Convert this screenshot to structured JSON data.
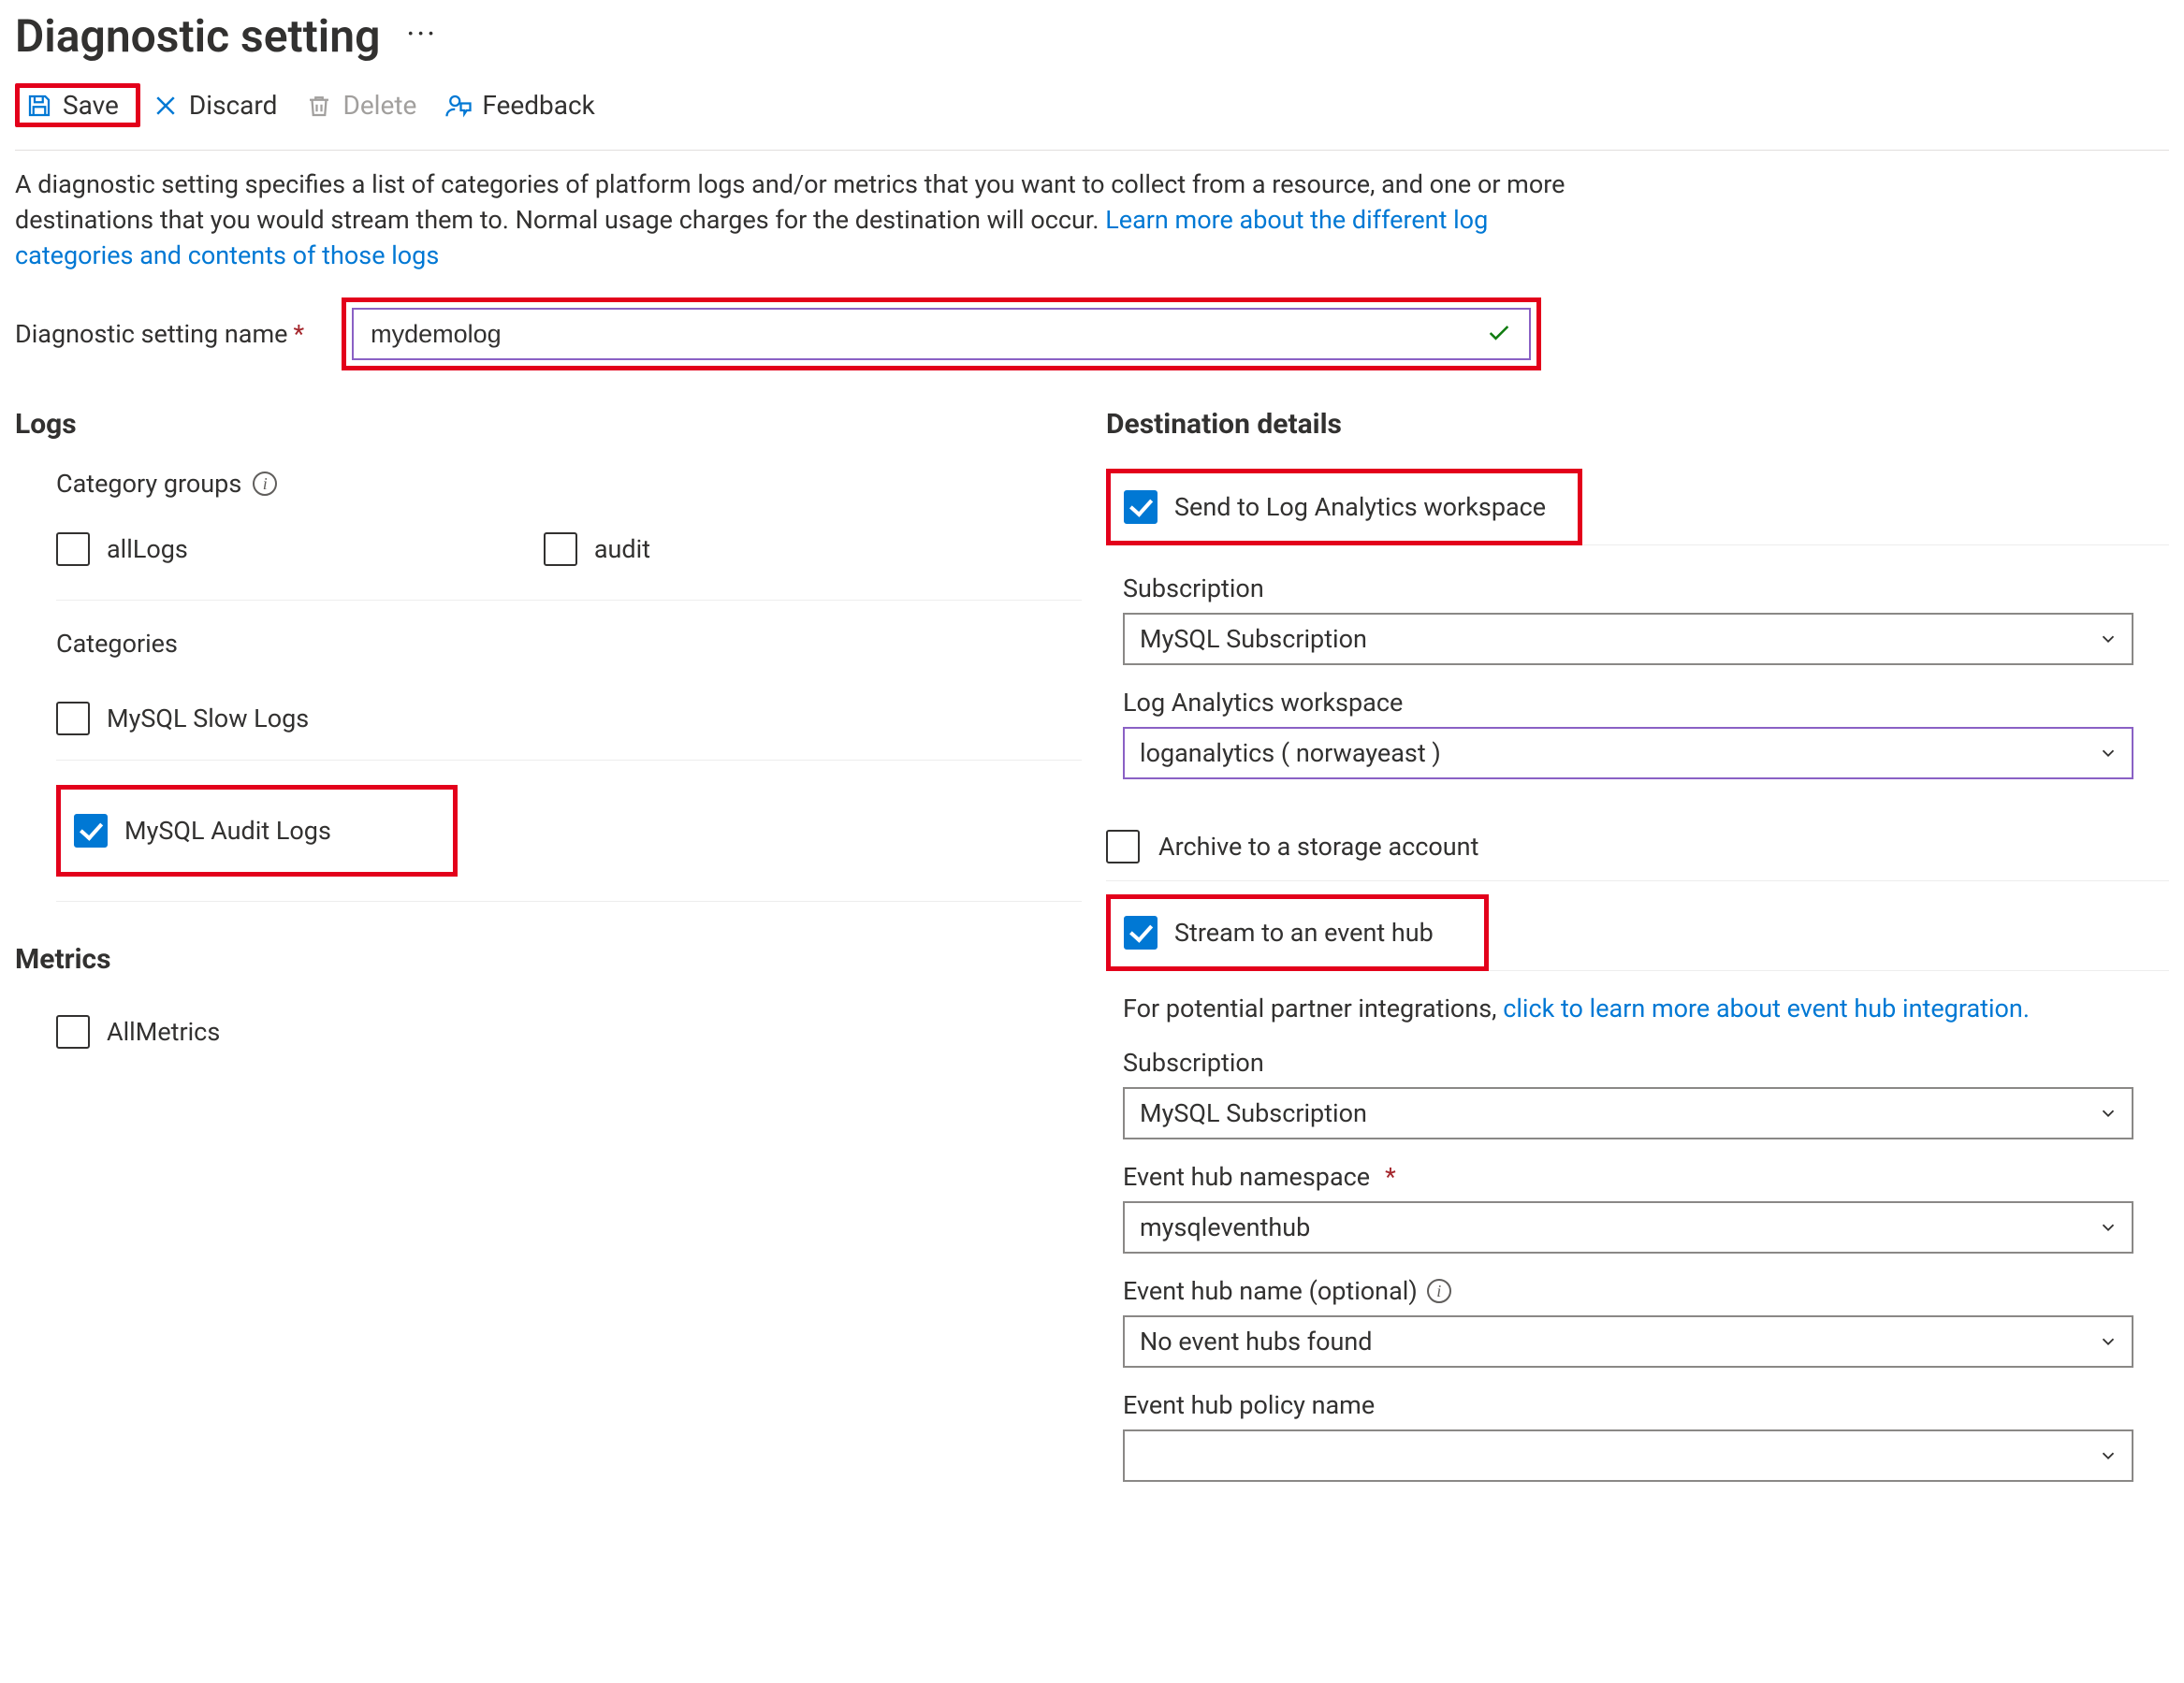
{
  "header": {
    "title": "Diagnostic setting",
    "more_icon": "more-icon"
  },
  "toolbar": {
    "save": "Save",
    "discard": "Discard",
    "delete": "Delete",
    "feedback": "Feedback"
  },
  "blurb": {
    "text_a": "A diagnostic setting specifies a list of categories of platform logs and/or metrics that you want to collect from a resource, and one or more destinations that you would stream them to. Normal usage charges for the destination will occur. ",
    "link": "Learn more about the different log categories and contents of those logs"
  },
  "name_field": {
    "label": "Diagnostic setting name",
    "value": "mydemolog",
    "valid": true
  },
  "logs": {
    "heading": "Logs",
    "category_groups_label": "Category groups",
    "groups": [
      {
        "label": "allLogs",
        "checked": false
      },
      {
        "label": "audit",
        "checked": false
      }
    ],
    "categories_label": "Categories",
    "categories": [
      {
        "label": "MySQL Slow Logs",
        "checked": false,
        "highlight": false
      },
      {
        "label": "MySQL Audit Logs",
        "checked": true,
        "highlight": true
      }
    ]
  },
  "metrics": {
    "heading": "Metrics",
    "items": [
      {
        "label": "AllMetrics",
        "checked": false
      }
    ]
  },
  "destination": {
    "heading": "Destination details",
    "law": {
      "label": "Send to Log Analytics workspace",
      "checked": true,
      "subscription_label": "Subscription",
      "subscription_value": "MySQL  Subscription",
      "workspace_label": "Log Analytics workspace",
      "workspace_value": "loganalytics ( norwayeast )"
    },
    "storage": {
      "label": "Archive to a storage account",
      "checked": false
    },
    "eventhub": {
      "label": "Stream to an event hub",
      "checked": true,
      "partner_prefix": "For potential partner integrations, ",
      "partner_link": "click to learn more about event hub integration.",
      "subscription_label": "Subscription",
      "subscription_value": "MySQL  Subscription",
      "namespace_label": "Event hub namespace",
      "namespace_value": "mysqleventhub",
      "hubname_label": "Event hub name (optional)",
      "hubname_value": "No event hubs found",
      "policy_label": "Event hub policy name",
      "policy_value": ""
    }
  }
}
